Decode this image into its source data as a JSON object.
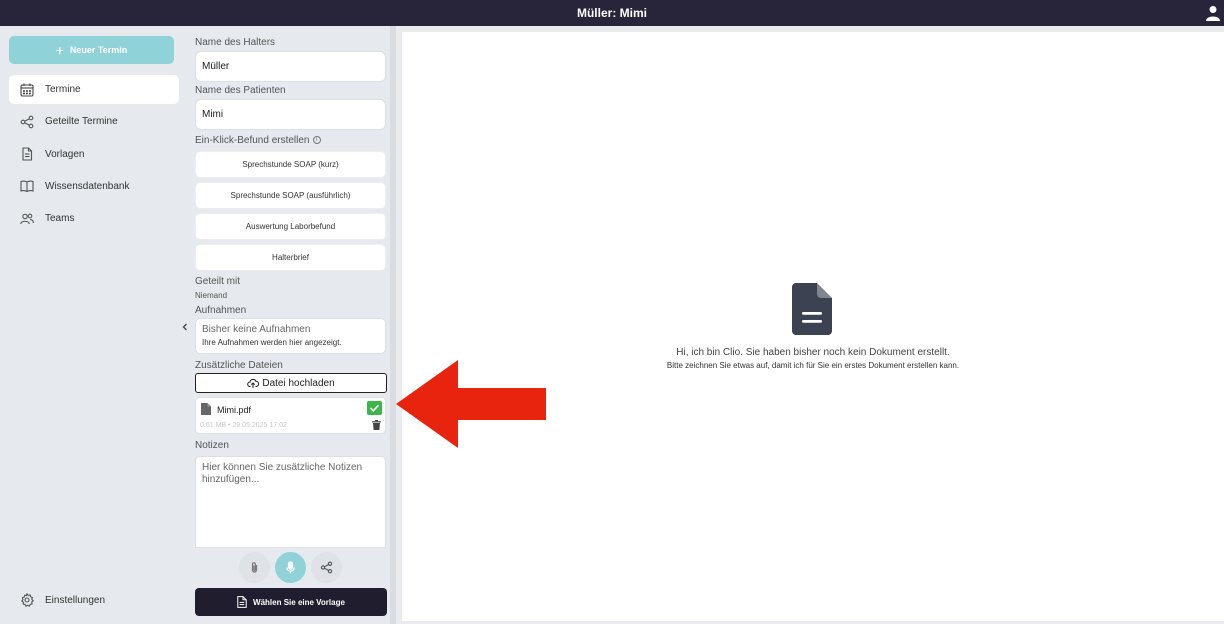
{
  "header": {
    "title": "Müller: Mimi"
  },
  "sidebar": {
    "new_button": "Neuer Termin",
    "items": [
      {
        "label": "Termine",
        "icon": "calendar-icon",
        "active": true
      },
      {
        "label": "Geteilte Termine",
        "icon": "share-icon"
      },
      {
        "label": "Vorlagen",
        "icon": "document-icon"
      },
      {
        "label": "Wissensdatenbank",
        "icon": "book-icon"
      },
      {
        "label": "Teams",
        "icon": "users-icon"
      }
    ],
    "settings": "Einstellungen"
  },
  "panel": {
    "owner_label": "Name des Halters",
    "owner_value": "Müller",
    "patient_label": "Name des Patienten",
    "patient_value": "Mimi",
    "oneclick_label": "Ein-Klick-Befund erstellen",
    "actions": [
      "Sprechstunde SOAP (kurz)",
      "Sprechstunde SOAP (ausführlich)",
      "Auswertung Laborbefund",
      "Halterbrief"
    ],
    "shared_label": "Geteilt mit",
    "shared_value": "Niemand",
    "recordings_label": "Aufnahmen",
    "recordings_empty": "Bisher keine Aufnahmen",
    "recordings_hint": "Ihre Aufnahmen werden hier angezeigt.",
    "files_label": "Zusätzliche Dateien",
    "upload_button": "Datei hochladen",
    "file": {
      "name": "Mimi.pdf",
      "meta": "0.61 MB • 29.05.2025 17:02"
    },
    "notes_label": "Notizen",
    "notes_placeholder": "Hier können Sie zusätzliche Notizen hinzufügen...",
    "template_button": "Wählen Sie eine Vorlage"
  },
  "main": {
    "message": "Hi, ich bin Clio. Sie haben bisher noch kein Dokument erstellt.",
    "hint": "Bitte zeichnen Sie etwas auf, damit ich für Sie ein erstes Dokument erstellen kann."
  },
  "colors": {
    "accent": "#8fd3d8",
    "dark": "#1f1d2e",
    "topbar": "#28253a",
    "annotation": "#e8240e",
    "success": "#3cb54a"
  }
}
